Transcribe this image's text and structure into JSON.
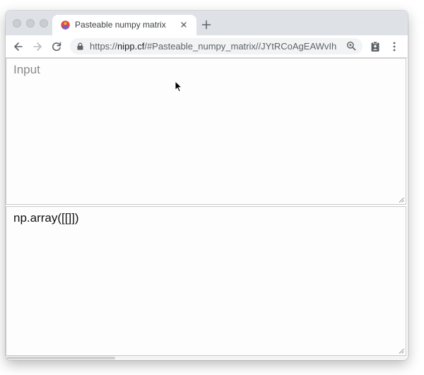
{
  "browser": {
    "tab": {
      "title": "Pasteable numpy matrix"
    },
    "address": {
      "scheme": "https://",
      "host": "nipp.cf",
      "path": "/#Pasteable_numpy_matrix//JYtRCoAgEAWvIhuk..."
    }
  },
  "page": {
    "input": {
      "placeholder": "Input"
    },
    "output": {
      "value": "np.array([[]])"
    }
  },
  "icons": {
    "favicon": "favicon-icon",
    "tab_close": "close-icon",
    "new_tab": "plus-icon",
    "back": "back-arrow-icon",
    "forward": "forward-arrow-icon",
    "reload": "reload-icon",
    "lock": "lock-icon",
    "zoom": "zoom-icon",
    "extension": "clipboard-icon",
    "menu": "kebab-menu-icon"
  }
}
